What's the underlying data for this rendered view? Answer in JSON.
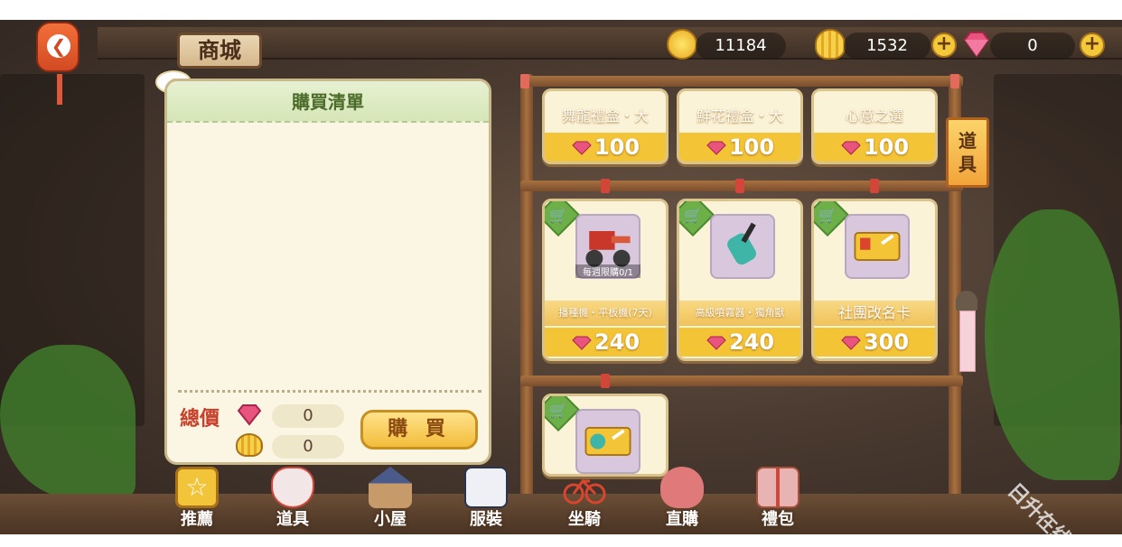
{
  "header": {
    "title": "商城",
    "currencies": [
      {
        "icon": "gold-coin-icon",
        "value": "11184"
      },
      {
        "icon": "seashell-coin-icon",
        "value": "1532"
      },
      {
        "icon": "pink-gem-icon",
        "value": "0"
      }
    ]
  },
  "purchase_list": {
    "title": "購買清單",
    "total_label": "總價",
    "gem_total": "0",
    "coin_total": "0",
    "buy_label": "購 買"
  },
  "shop": {
    "side_tab_label": "道具",
    "rows": [
      [
        {
          "name": "舞龍禮盒・大",
          "price": "100"
        },
        {
          "name": "鮮花禮盒・大",
          "price": "100"
        },
        {
          "name": "心意之選",
          "price": "100"
        }
      ],
      [
        {
          "name": "播種機・平板機(7天)",
          "price": "240",
          "tag": "每週限購0/1",
          "icon": "seeder-machine-icon"
        },
        {
          "name": "高級噴霧器・獨角獸",
          "price": "240",
          "icon": "sprayer-icon"
        },
        {
          "name": "社團改名卡",
          "price": "300",
          "icon": "rename-card-icon"
        }
      ],
      [
        {
          "name": "",
          "price": "",
          "icon": "name-card-icon"
        }
      ]
    ]
  },
  "bottom_nav": [
    {
      "label": "推薦",
      "icon": "star-icon",
      "color": "#f1c43a"
    },
    {
      "label": "道具",
      "icon": "fox-mask-icon",
      "color": "#f3e6e6"
    },
    {
      "label": "小屋",
      "icon": "house-icon",
      "color": "#5a6a9a"
    },
    {
      "label": "服裝",
      "icon": "sailor-uniform-icon",
      "color": "#eef0f5"
    },
    {
      "label": "坐騎",
      "icon": "bicycle-icon",
      "color": "#d9452e"
    },
    {
      "label": "直購",
      "icon": "money-bag-icon",
      "color": "#e07a7a"
    },
    {
      "label": "禮包",
      "icon": "gift-box-icon",
      "color": "#e8b3b3"
    }
  ],
  "watermark": "日升在线",
  "colors": {
    "accent": "#f4c437",
    "gem": "#e0457a",
    "green": "#6db04a"
  }
}
